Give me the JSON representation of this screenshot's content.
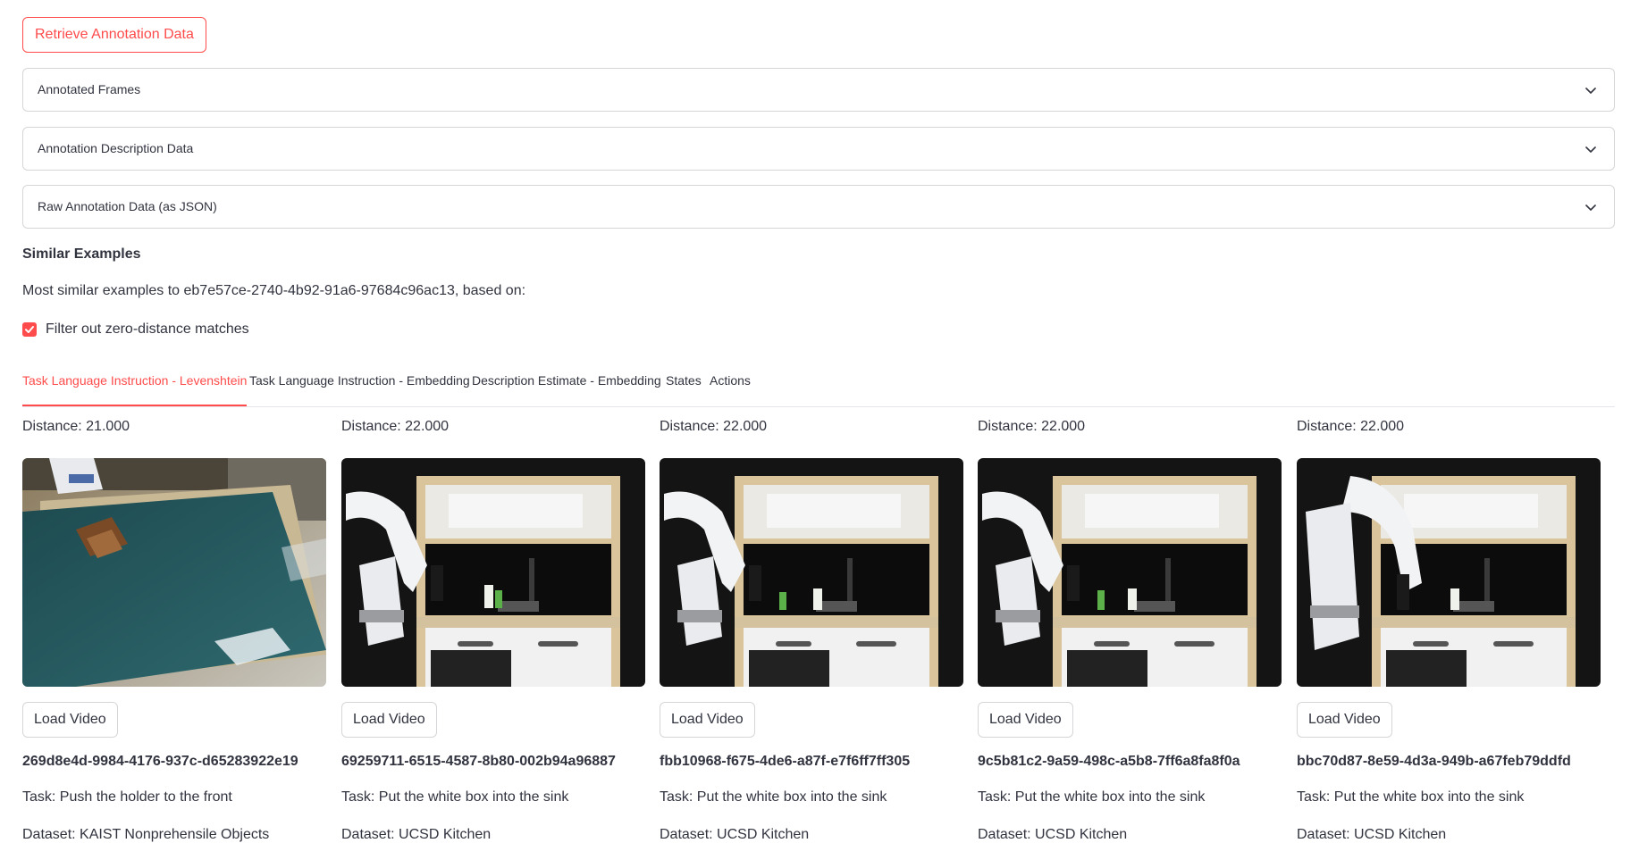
{
  "retrieve_button": {
    "label": "Retrieve Annotation Data"
  },
  "expanders": [
    {
      "label": "Annotated Frames"
    },
    {
      "label": "Annotation Description Data"
    },
    {
      "label": "Raw Annotation Data (as JSON)"
    }
  ],
  "similar": {
    "heading": "Similar Examples",
    "subtext": "Most similar examples to eb7e57ce-2740-4b92-91a6-97684c96ac13, based on:",
    "filter_checkbox": {
      "label": "Filter out zero-distance matches",
      "checked": true
    }
  },
  "tabs": [
    {
      "label": "Task Language Instruction - Levenshtein",
      "active": true
    },
    {
      "label": "Task Language Instruction - Embedding",
      "active": false
    },
    {
      "label": "Description Estimate - Embedding",
      "active": false
    },
    {
      "label": "States",
      "active": false
    },
    {
      "label": "Actions",
      "active": false
    }
  ],
  "results": [
    {
      "distance": "Distance: 21.000",
      "image": "robot-table-push-scene",
      "load_label": "Load Video",
      "episode_id": "269d8e4d-9984-4176-937c-d65283922e19",
      "task": "Task: Push the holder to the front",
      "dataset": "Dataset: KAIST Nonprehensile Objects"
    },
    {
      "distance": "Distance: 22.000",
      "image": "robot-kitchen-sink-scene",
      "load_label": "Load Video",
      "episode_id": "69259711-6515-4587-8b80-002b94a96887",
      "task": "Task: Put the white box into the sink",
      "dataset": "Dataset: UCSD Kitchen"
    },
    {
      "distance": "Distance: 22.000",
      "image": "robot-kitchen-sink-scene",
      "load_label": "Load Video",
      "episode_id": "fbb10968-f675-4de6-a87f-e7f6ff7ff305",
      "task": "Task: Put the white box into the sink",
      "dataset": "Dataset: UCSD Kitchen"
    },
    {
      "distance": "Distance: 22.000",
      "image": "robot-kitchen-sink-scene",
      "load_label": "Load Video",
      "episode_id": "9c5b81c2-9a59-498c-a5b8-7ff6a8fa8f0a",
      "task": "Task: Put the white box into the sink",
      "dataset": "Dataset: UCSD Kitchen"
    },
    {
      "distance": "Distance: 22.000",
      "image": "robot-kitchen-sink-scene",
      "load_label": "Load Video",
      "episode_id": "bbc70d87-8e59-4d3a-949b-a67feb79ddfd",
      "task": "Task: Put the white box into the sink",
      "dataset": "Dataset: UCSD Kitchen"
    }
  ],
  "colors": {
    "accent": "#ff4b4b",
    "text": "#31333f",
    "border": "#d6d6d9"
  }
}
